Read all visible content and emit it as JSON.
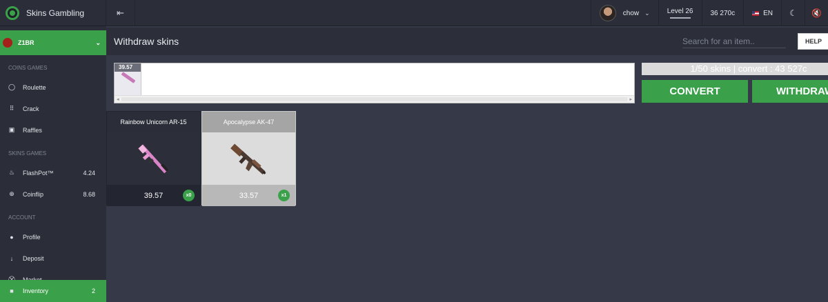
{
  "brand": {
    "name": "Skins Gambling"
  },
  "topbar": {
    "username": "chow",
    "level": "Level 26",
    "balance": "36 270c",
    "language": "EN"
  },
  "sidebar": {
    "user_name": "Z1BR",
    "sections": [
      {
        "title": "COINS GAMES",
        "items": [
          {
            "label": "Roulette",
            "icon": "circle-icon"
          },
          {
            "label": "Crack",
            "icon": "grid-icon"
          },
          {
            "label": "Raffles",
            "icon": "box-icon"
          }
        ]
      },
      {
        "title": "SKINS GAMES",
        "items": [
          {
            "label": "FlashPot™",
            "value": "4.24",
            "icon": "flame-icon"
          },
          {
            "label": "Coinflip",
            "value": "8.68",
            "icon": "target-icon"
          }
        ]
      },
      {
        "title": "ACCOUNT",
        "items": [
          {
            "label": "Profile",
            "icon": "user-icon"
          },
          {
            "label": "Deposit",
            "icon": "arrow-down-icon"
          },
          {
            "label": "Market",
            "icon": "basket-icon"
          }
        ]
      }
    ],
    "active_item": {
      "label": "Inventory",
      "value": "2",
      "icon": "briefcase-icon"
    }
  },
  "main": {
    "title": "Withdraw skins",
    "search_placeholder": "Search for an item..",
    "help_label": "HELP",
    "selected_strip": {
      "price": "39.57"
    },
    "summary": "1/50 skins | convert : 43 527c",
    "convert_label": "CONVERT",
    "withdraw_label": "WITHDRAW",
    "cards": [
      {
        "name": "Rainbow Unicorn AR-15",
        "price": "39.57",
        "count": "x0"
      },
      {
        "name": "Apocalypse AK-47",
        "price": "33.57",
        "count": "x1"
      }
    ]
  },
  "colors": {
    "accent": "#3aa14a",
    "background": "#363a48",
    "panel": "#2b2e38"
  }
}
